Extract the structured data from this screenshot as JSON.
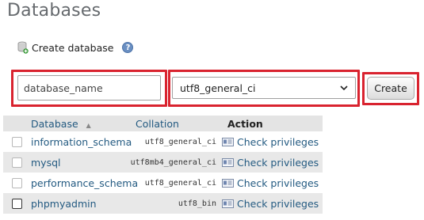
{
  "page": {
    "title": "Databases"
  },
  "create": {
    "label": "Create database",
    "help_icon": "?",
    "name_placeholder": "database_name",
    "collation_value": "utf8_general_ci",
    "button_label": "Create"
  },
  "table": {
    "headers": {
      "database": "Database",
      "collation": "Collation",
      "action": "Action"
    },
    "rows": [
      {
        "name": "information_schema",
        "collation": "utf8_general_ci",
        "action": "Check privileges"
      },
      {
        "name": "mysql",
        "collation": "utf8mb4_general_ci",
        "action": "Check privileges"
      },
      {
        "name": "performance_schema",
        "collation": "utf8_general_ci",
        "action": "Check privileges"
      },
      {
        "name": "phpmyadmin",
        "collation": "utf8_bin",
        "action": "Check privileges"
      }
    ]
  },
  "colors": {
    "highlight": "#d9232f",
    "link": "#235a81",
    "title": "#666a6e"
  }
}
